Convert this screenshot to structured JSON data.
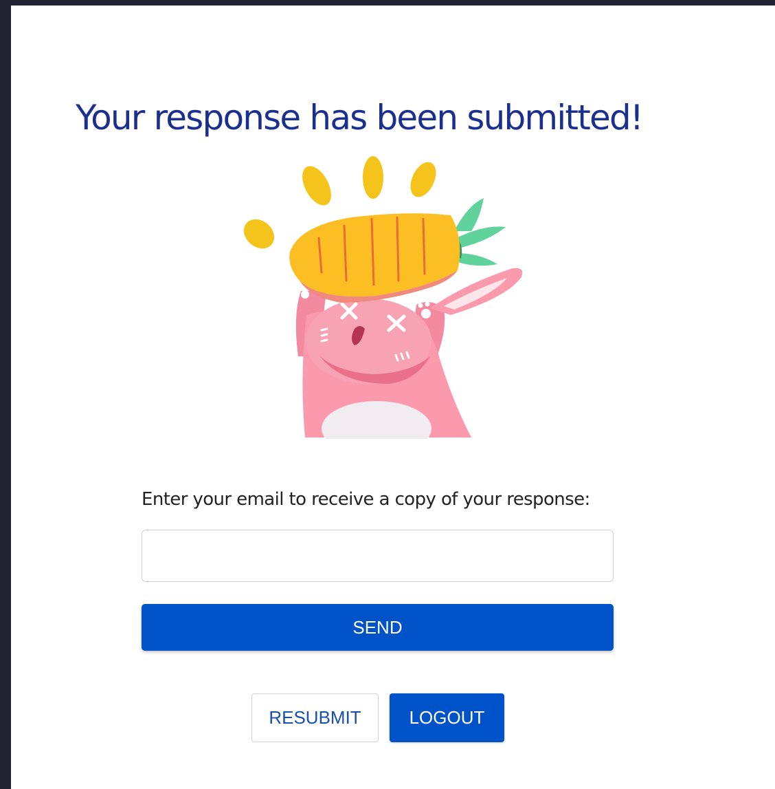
{
  "confirmation": {
    "title": "Your response has been submitted!",
    "illustration": "bunny-holding-carrot"
  },
  "email_copy": {
    "prompt": "Enter your email to receive a copy of your response:",
    "input_value": "",
    "input_placeholder": "",
    "send_label": "SEND"
  },
  "actions": {
    "resubmit_label": "RESUBMIT",
    "logout_label": "LOGOUT"
  },
  "colors": {
    "title": "#1b2f8f",
    "primary_button": "#0052c8",
    "secondary_button_text": "#1a4fb0",
    "page_background": "#ffffff",
    "outer_background": "#1f2430"
  }
}
